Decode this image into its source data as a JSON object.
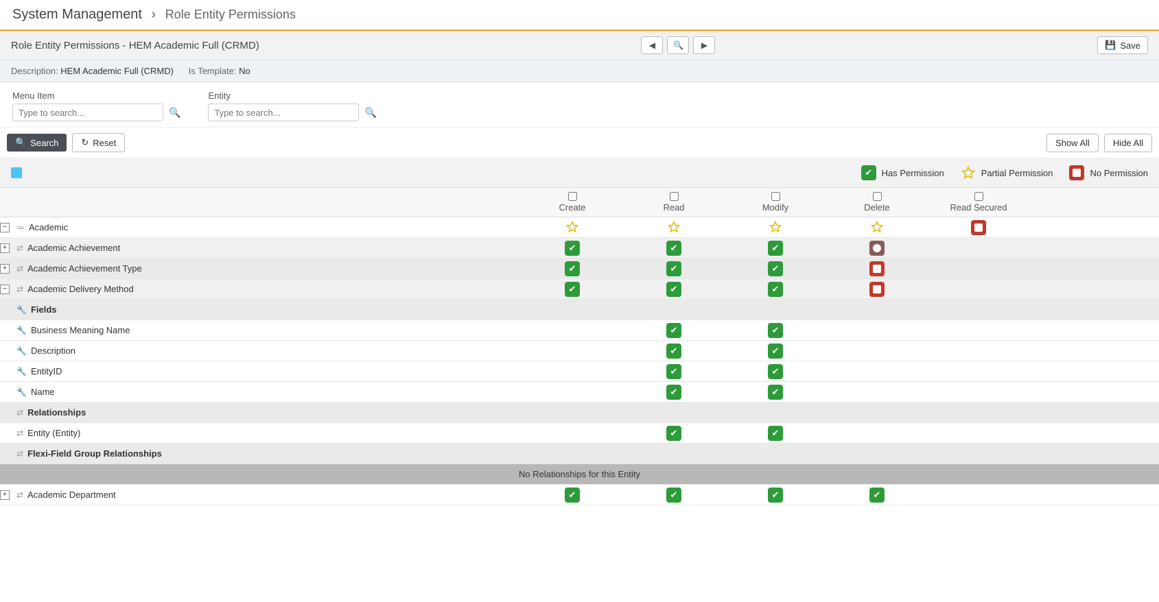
{
  "breadcrumb": {
    "root": "System Management",
    "page": "Role Entity Permissions"
  },
  "title": "Role Entity Permissions - HEM Academic Full (CRMD)",
  "save_label": "Save",
  "desc": {
    "description_label": "Description:",
    "description_value": "HEM Academic Full (CRMD)",
    "template_label": "Is Template:",
    "template_value": "No"
  },
  "filters": {
    "menu_label": "Menu Item",
    "menu_placeholder": "Type to search...",
    "entity_label": "Entity",
    "entity_placeholder": "Type to search..."
  },
  "actions": {
    "search": "Search",
    "reset": "Reset",
    "show_all": "Show All",
    "hide_all": "Hide All"
  },
  "legend": {
    "has": "Has Permission",
    "partial": "Partial Permission",
    "no": "No Permission"
  },
  "cols": {
    "create": "Create",
    "read": "Read",
    "modify": "Modify",
    "delete": "Delete",
    "read_secured": "Read Secured"
  },
  "rows": {
    "academic": "Academic",
    "acad_achieve": "Academic Achievement",
    "acad_achieve_type": "Academic Achievement Type",
    "acad_delivery": "Academic Delivery Method",
    "fields_header": "Fields",
    "f_bmn": "Business Meaning Name",
    "f_desc": "Description",
    "f_eid": "EntityID",
    "f_name": "Name",
    "rel_header": "Relationships",
    "rel_entity": "Entity (Entity)",
    "flexi_header": "Flexi-Field Group Relationships",
    "no_rel_msg": "No Relationships for this Entity",
    "acad_dept": "Academic Department"
  }
}
